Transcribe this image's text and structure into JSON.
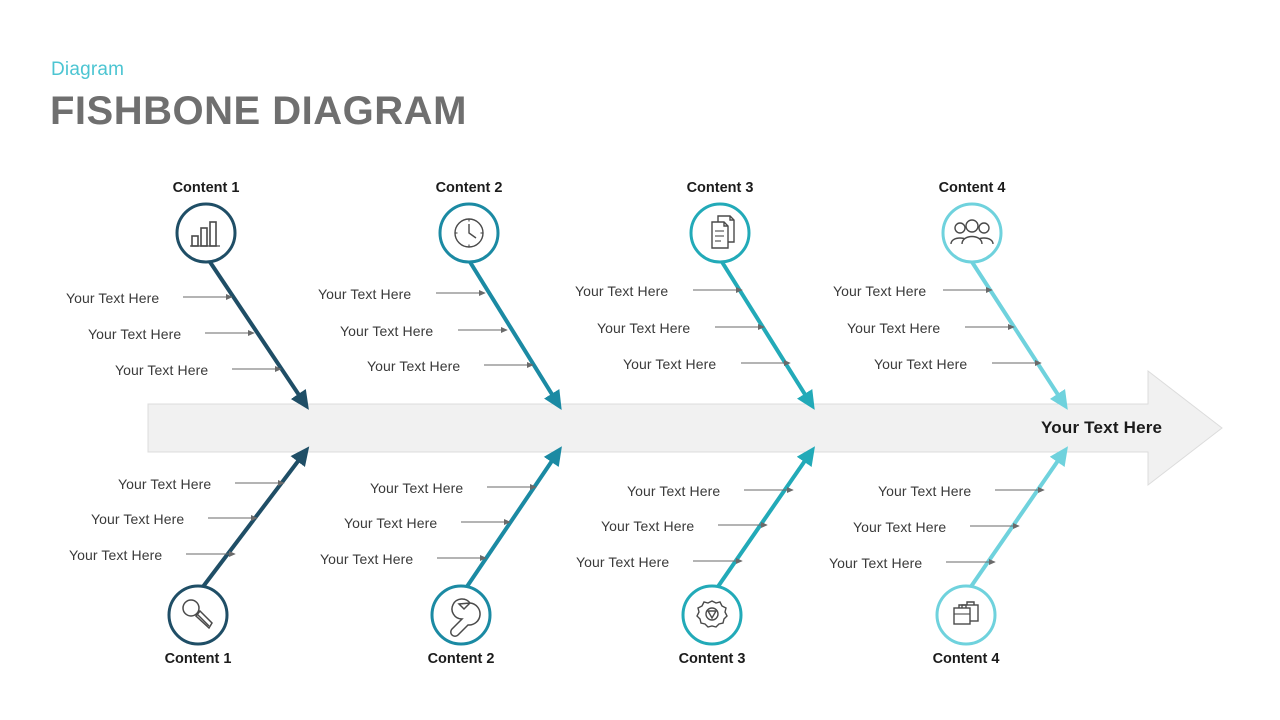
{
  "header": {
    "kicker": "Diagram",
    "title": "FISHBONE DIAGRAM",
    "kicker_color": "#4cc5d2",
    "title_color": "#6f6f6f"
  },
  "spine": {
    "label": "Your Text Here",
    "fill": "#f1f1f1",
    "stroke": "#dcdcdc"
  },
  "cause_label": "Your Text Here",
  "branches": [
    {
      "position": "top",
      "index": 1,
      "label": "Content 1",
      "icon": "bar-chart-icon",
      "color": "#1f4e66",
      "causes": [
        "Your Text Here",
        "Your Text Here",
        "Your Text Here"
      ]
    },
    {
      "position": "top",
      "index": 2,
      "label": "Content 2",
      "icon": "clock-icon",
      "color": "#1b8aa3",
      "causes": [
        "Your Text Here",
        "Your Text Here",
        "Your Text Here"
      ]
    },
    {
      "position": "top",
      "index": 3,
      "label": "Content 3",
      "icon": "documents-icon",
      "color": "#22aab8",
      "causes": [
        "Your Text Here",
        "Your Text Here",
        "Your Text Here"
      ]
    },
    {
      "position": "top",
      "index": 4,
      "label": "Content 4",
      "icon": "users-group-icon",
      "color": "#6fd2dd",
      "causes": [
        "Your Text Here",
        "Your Text Here",
        "Your Text Here"
      ]
    },
    {
      "position": "bottom",
      "index": 1,
      "label": "Content 1",
      "icon": "microphone-icon",
      "color": "#1f4e66",
      "causes": [
        "Your Text Here",
        "Your Text Here",
        "Your Text Here"
      ]
    },
    {
      "position": "bottom",
      "index": 2,
      "label": "Content 2",
      "icon": "wrench-icon",
      "color": "#1b8aa3",
      "causes": [
        "Your Text Here",
        "Your Text Here",
        "Your Text Here"
      ]
    },
    {
      "position": "bottom",
      "index": 3,
      "label": "Content 3",
      "icon": "gear-icon",
      "color": "#22aab8",
      "causes": [
        "Your Text Here",
        "Your Text Here",
        "Your Text Here"
      ]
    },
    {
      "position": "bottom",
      "index": 4,
      "label": "Content 4",
      "icon": "briefcase-icon",
      "color": "#6fd2dd",
      "causes": [
        "Your Text Here",
        "Your Text Here",
        "Your Text Here"
      ]
    }
  ]
}
